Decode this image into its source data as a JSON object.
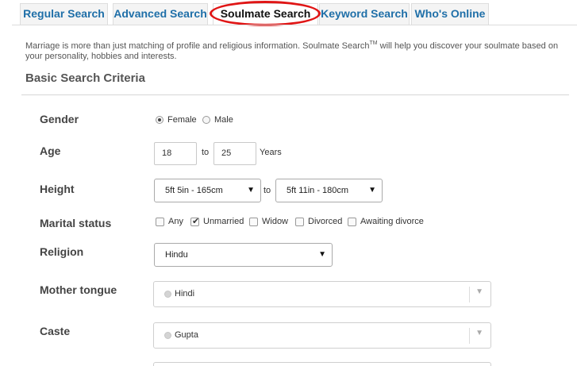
{
  "tabs": [
    {
      "label": "Regular Search",
      "active": false
    },
    {
      "label": "Advanced Search",
      "active": false
    },
    {
      "label": "Soulmate Search",
      "active": true
    },
    {
      "label": "Keyword Search",
      "active": false
    },
    {
      "label": "Who's Online",
      "active": false
    }
  ],
  "intro": {
    "text_before": "Marriage is more than just matching of profile and religious information. Soulmate Search",
    "tm": "TM",
    "text_after": " will help you discover your soulmate based on your personality, hobbies and interests."
  },
  "section_title": "Basic Search Criteria",
  "fields": {
    "gender": {
      "label": "Gender",
      "options": [
        "Female",
        "Male"
      ],
      "selected": "Female"
    },
    "age": {
      "label": "Age",
      "from": "18",
      "to_word": "to",
      "to": "25",
      "unit": "Years"
    },
    "height": {
      "label": "Height",
      "from": "5ft 5in - 165cm",
      "to_word": "to",
      "to": "5ft 11in - 180cm"
    },
    "marital_status": {
      "label": "Marital status",
      "options": [
        "Any",
        "Unmarried",
        "Widow",
        "Divorced",
        "Awaiting divorce"
      ],
      "checked": [
        "Unmarried"
      ]
    },
    "religion": {
      "label": "Religion",
      "value": "Hindu"
    },
    "mother_tongue": {
      "label": "Mother tongue",
      "value": "Hindi"
    },
    "caste": {
      "label": "Caste",
      "value": "Gupta"
    }
  },
  "accent": {
    "link_blue": "#1f6fa8",
    "highlight_red": "#e01515"
  }
}
